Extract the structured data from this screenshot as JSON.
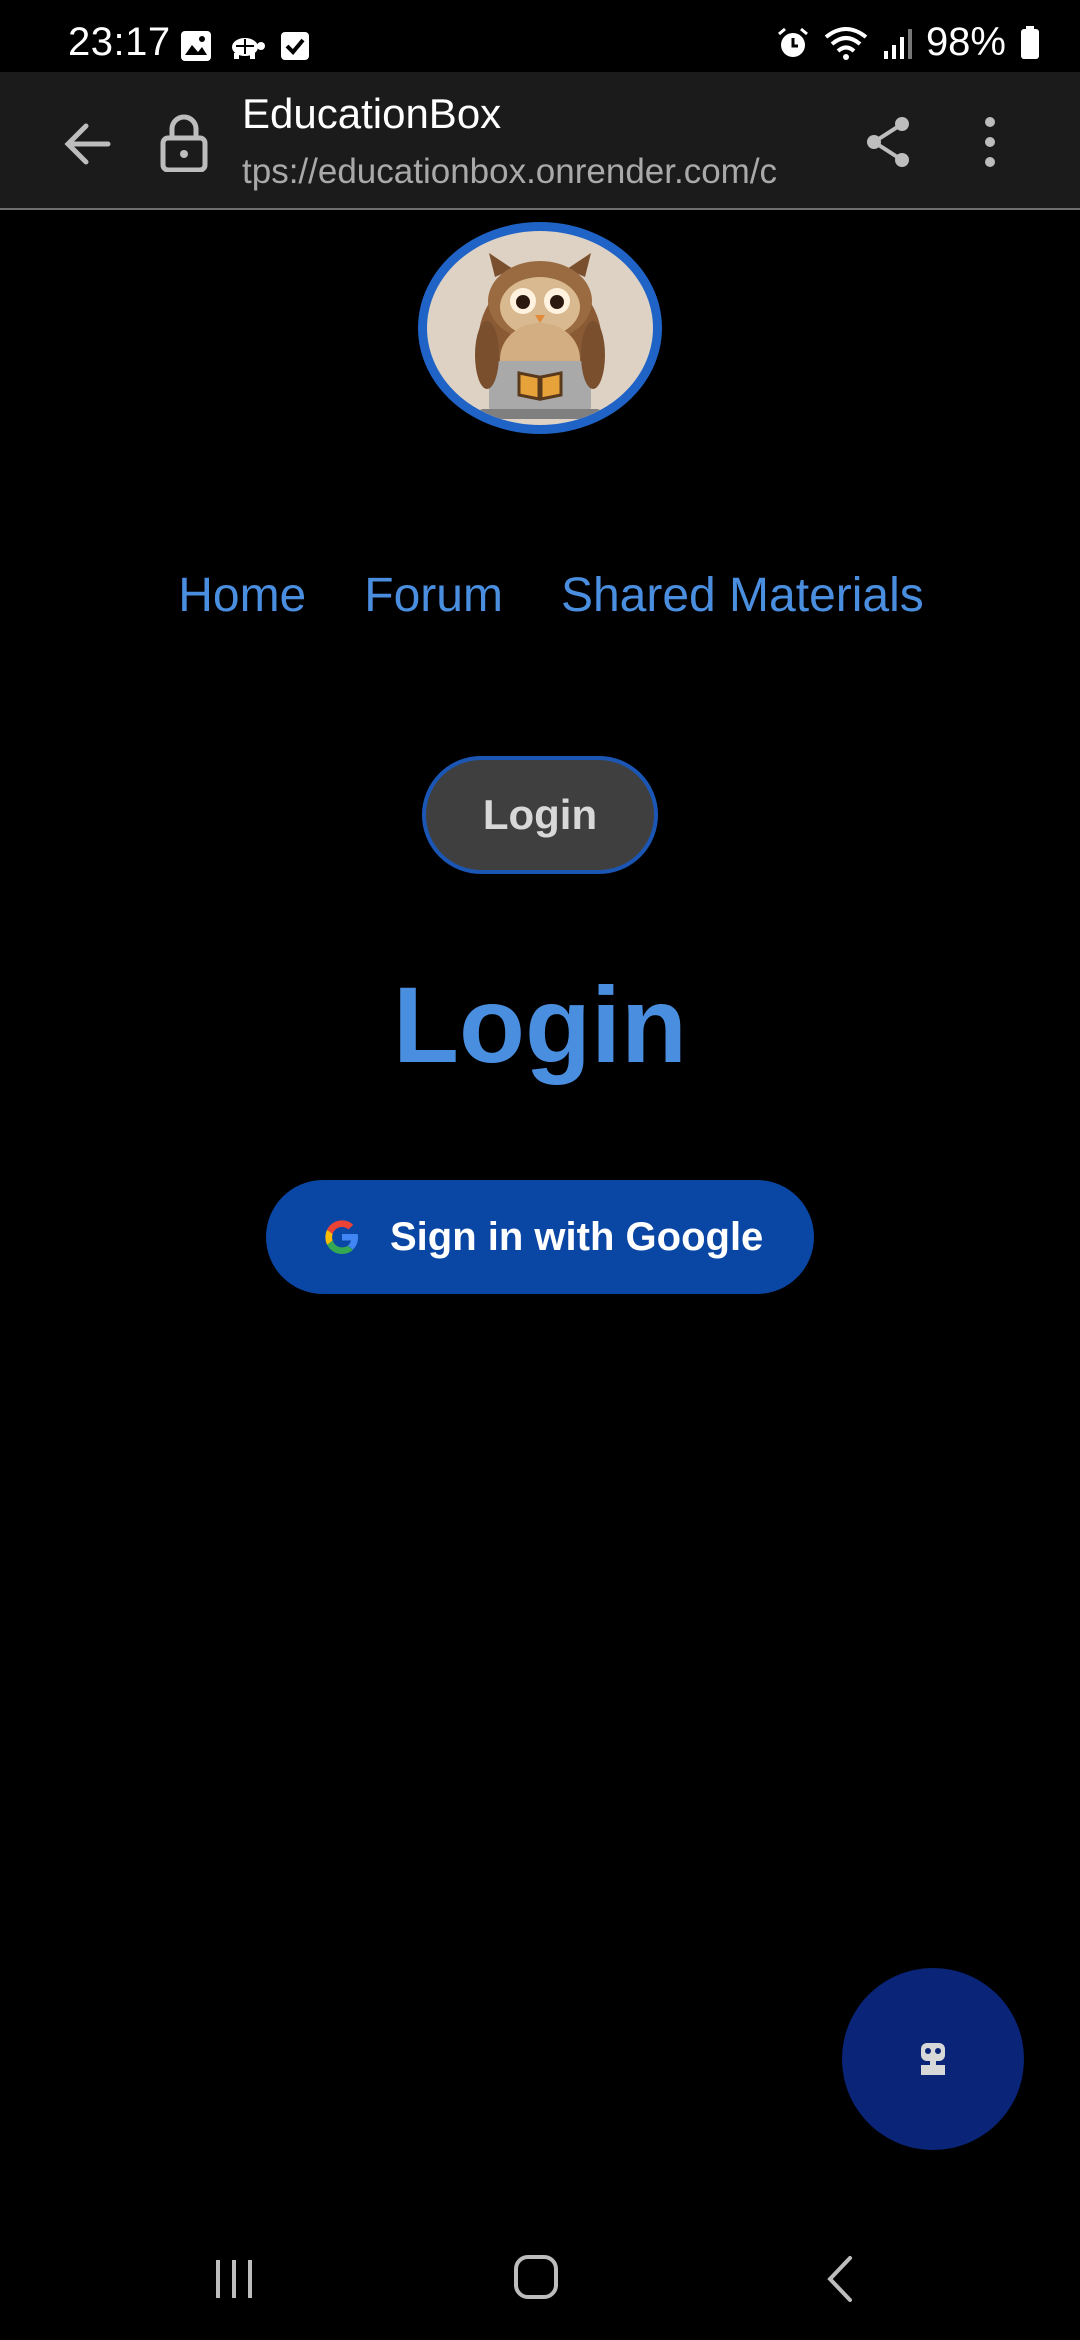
{
  "status_bar": {
    "time": "23:17",
    "battery": "98%",
    "left_icons": [
      "gallery-icon",
      "turtle-icon",
      "checkbox-icon"
    ],
    "right_icons": [
      "alarm-icon",
      "wifi-icon",
      "signal-icon",
      "battery-icon"
    ]
  },
  "browser": {
    "title": "EducationBox",
    "url": "tps://educationbox.onrender.com/c"
  },
  "nav": {
    "items": [
      "Home",
      "Forum",
      "Shared Materials"
    ]
  },
  "login_button": "Login",
  "heading": "Login",
  "google_button": "Sign in with Google",
  "colors": {
    "accent": "#4a8ee0",
    "google_button_bg": "#0a46a3",
    "fab_bg": "#0a2477",
    "toolbar_bg": "#1b1b1b"
  }
}
